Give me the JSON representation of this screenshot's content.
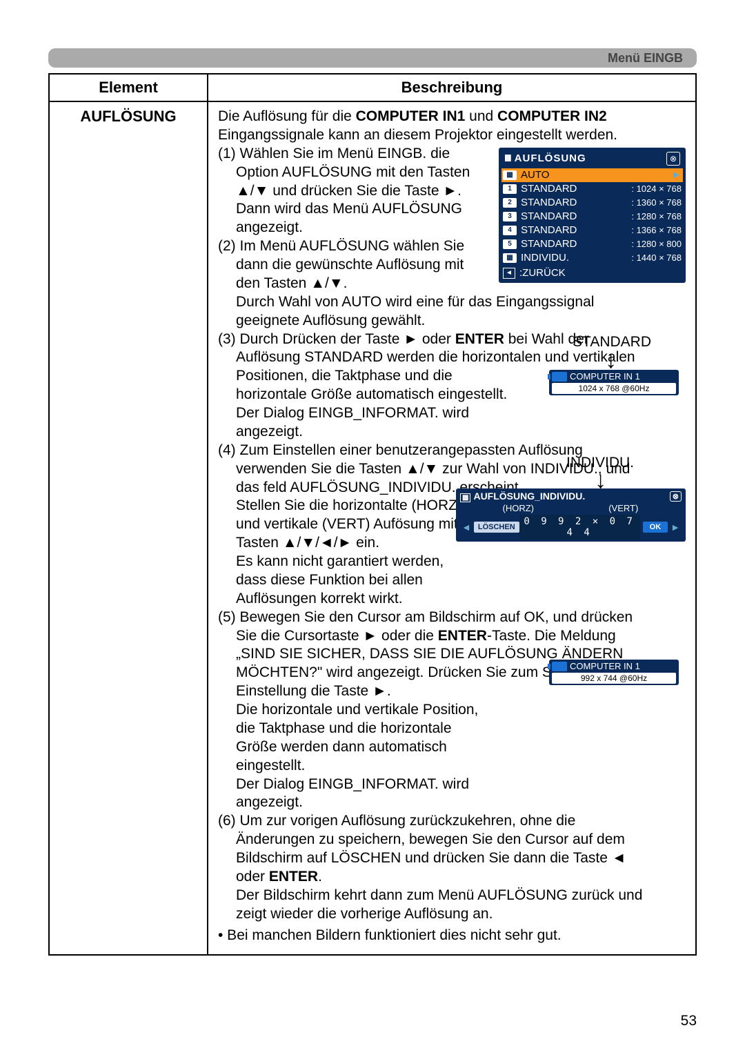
{
  "header": {
    "title": "Menü EINGB"
  },
  "table": {
    "col1": "Element",
    "col2": "Beschreibung",
    "element": "AUFLÖSUNG",
    "intro_a": "Die Auflösung für die ",
    "intro_b": "COMPUTER IN1",
    "intro_c": " und ",
    "intro_d": "COMPUTER IN2",
    "intro_e": " Eingangssignale kann an diesem Projektor eingestellt werden.",
    "s1a": "(1) Wählen Sie im Menü EINGB. die",
    "s1b": "Option AUFLÖSUNG mit den Tasten",
    "s1c": "▲/▼ und drücken Sie die Taste ►.",
    "s1d": "Dann wird das Menü AUFLÖSUNG",
    "s1e": "angezeigt.",
    "s2a": "(2) Im Menü AUFLÖSUNG wählen Sie",
    "s2b": "dann die gewünschte Auflösung mit",
    "s2c": "den Tasten ▲/▼.",
    "s2d": "Durch Wahl von AUTO wird eine für das Eingangssignal",
    "s2e": "geeignete Auflösung gewählt.",
    "s3a_pre": "(3) Durch Drücken der Taste ► oder ",
    "s3a_b": "ENTER",
    "s3a_post": " bei Wahl der",
    "s3b": "Auflösung STANDARD werden die horizontalen und vertikalen",
    "s3c": "Positionen, die Taktphase und die",
    "s3d": "horizontale Größe automatisch eingestellt.",
    "s3e": "Der Dialog EINGB_INFORMAT. wird",
    "s3f": "angezeigt.",
    "s4a": "(4) Zum Einstellen einer benutzerangepassten Auflösung",
    "s4b": "verwenden Sie die Tasten ▲/▼ zur Wahl  von INDIVIDU., und",
    "s4c": "das feld AUFLÖSUNG_INDIVIDU. erscheint.",
    "s4d": "Stellen Sie die horizontalte (HORZ)",
    "s4e": "und vertikale (VERT) Aufösung mit den",
    "s4f": "Tasten ▲/▼/◄/► ein.",
    "s4g": "Es kann nicht garantiert werden,",
    "s4h": "dass diese Funktion bei allen",
    "s4i": "Auflösungen korrekt wirkt.",
    "s5a": "(5) Bewegen Sie den Cursor am Bildschirm auf OK, und drücken",
    "s5b_pre": "Sie die Cursortaste ► oder die ",
    "s5b_b": "ENTER",
    "s5b_post": "-Taste. Die Meldung",
    "s5c": "„SIND SIE SICHER, DASS SIE DIE AUFLÖSUNG ÄNDERN",
    "s5d": "MÖCHTEN?\" wird angezeigt. Drücken Sie zum Speichern der",
    "s5e": "Einstellung die Taste ►.",
    "s5f": "Die horizontale und vertikale Position,",
    "s5g": "die Taktphase und die horizontale",
    "s5h": "Größe werden dann automatisch",
    "s5i": "eingestellt.",
    "s5j": "Der Dialog EINGB_INFORMAT. wird",
    "s5k": "angezeigt.",
    "s6a": "(6) Um zur vorigen Auflösung zurückzukehren, ohne die",
    "s6b": "Änderungen zu speichern, bewegen Sie den Cursor auf dem",
    "s6c": "Bildschirm auf LÖSCHEN und drücken Sie dann die Taste ◄",
    "s6d_pre": "oder ",
    "s6d_b": "ENTER",
    "s6d_post": ".",
    "s6e": "Der Bildschirm kehrt dann zum Menü AUFLÖSUNG zurück und",
    "s6f": "zeigt wieder die vorherige Auflösung an.",
    "note": "• Bei manchen Bildern funktioniert dies nicht sehr gut."
  },
  "osd_menu": {
    "title": "AUFLÖSUNG",
    "items": [
      {
        "tag": "",
        "name": "AUTO",
        "val": "",
        "sel": true,
        "chev": true
      },
      {
        "tag": "1",
        "name": "STANDARD",
        "val": ": 1024 × 768"
      },
      {
        "tag": "2",
        "name": "STANDARD",
        "val": ": 1360 × 768"
      },
      {
        "tag": "3",
        "name": "STANDARD",
        "val": ": 1280 × 768"
      },
      {
        "tag": "4",
        "name": "STANDARD",
        "val": ": 1366 × 768"
      },
      {
        "tag": "5",
        "name": "STANDARD",
        "val": ": 1280 × 800"
      },
      {
        "tag": "",
        "name": "INDIVIDU.",
        "val": ": 1440 × 768"
      }
    ],
    "back": "ZURÜCK"
  },
  "label_standard": "STANDARD",
  "label_individu": "INDIVIDU.",
  "chip1": {
    "src": "COMPUTER IN 1",
    "res": "1024 x 768 @60Hz"
  },
  "chip2": {
    "src": "COMPUTER IN 1",
    "res": "992 x 744 @60Hz"
  },
  "osd_indiv": {
    "title": "AUFLÖSUNG_INDIVIDU.",
    "horz": "(HORZ)",
    "vert": "(VERT)",
    "del": "LÖSCHEN",
    "vals": "0 9 9 2 × 0 7 4 4",
    "ok": "OK"
  },
  "page_number": "53"
}
